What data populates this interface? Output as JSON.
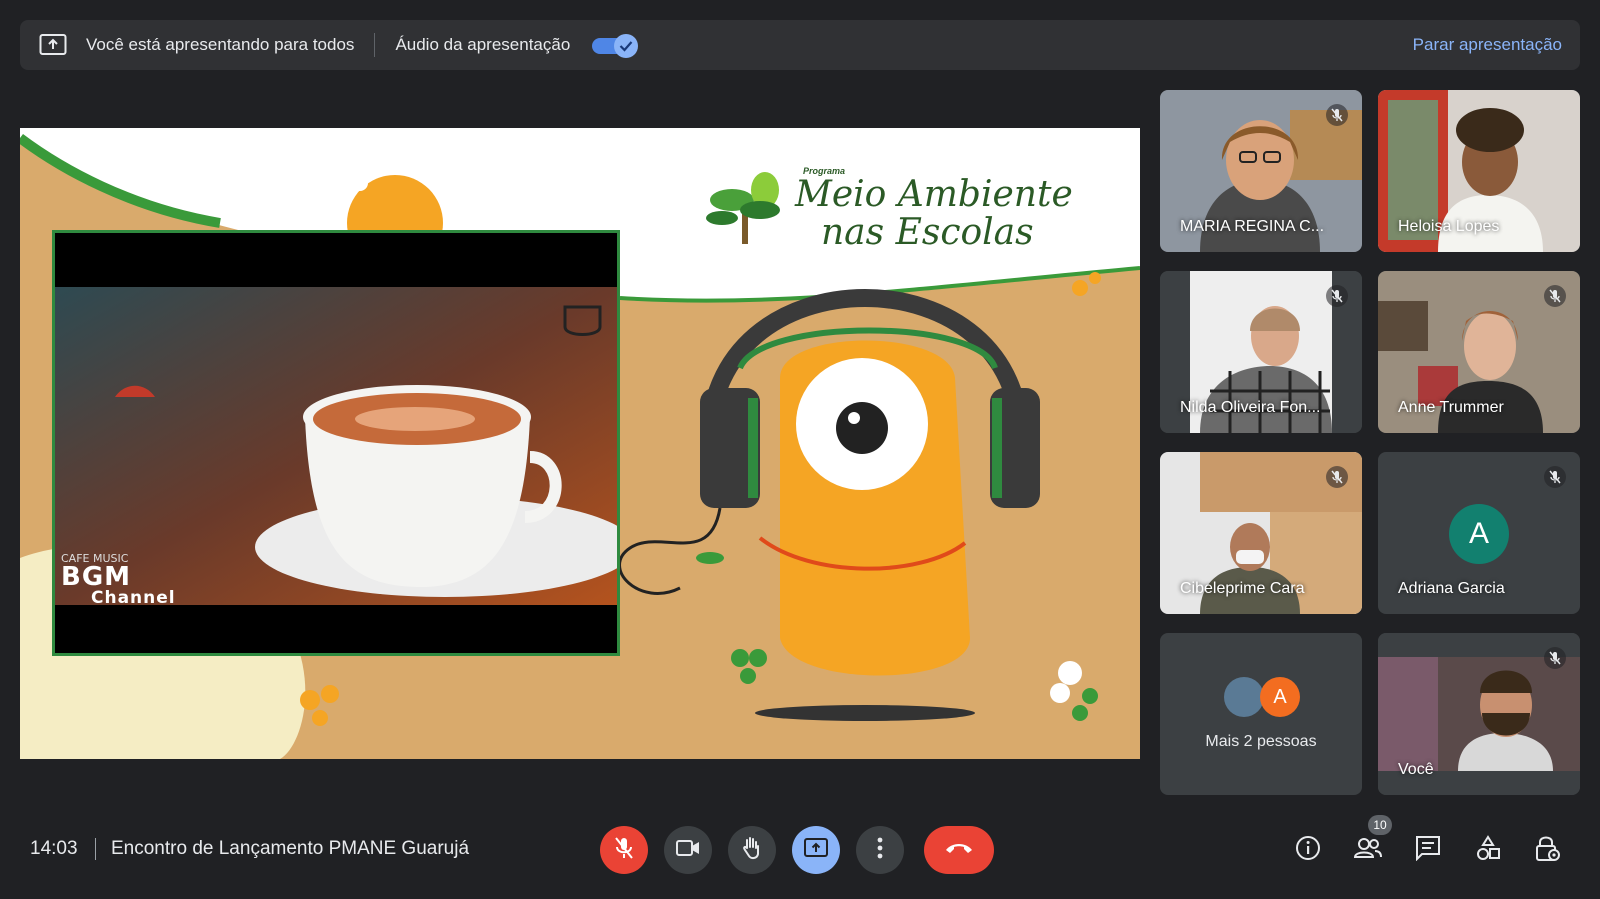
{
  "banner": {
    "presenting_text": "Você está apresentando para todos",
    "audio_label": "Áudio da apresentação",
    "audio_enabled": true,
    "stop_label": "Parar apresentação"
  },
  "slide": {
    "program_prefix": "Programa",
    "program_line1": "Meio Ambiente",
    "program_line2": "nas Escolas",
    "video_overlay_small": "CAFE MUSIC",
    "video_overlay_big": "BGM",
    "video_overlay_channel": "Channel"
  },
  "participants": [
    {
      "name": "MARIA REGINA C...",
      "muted": true
    },
    {
      "name": "Heloisa Lopes",
      "muted": false
    },
    {
      "name": "Nilda Oliveira Fon...",
      "muted": true
    },
    {
      "name": "Anne Trummer",
      "muted": true
    },
    {
      "name": "Cibeleprime Cara",
      "muted": true
    },
    {
      "name": "Adriana Garcia",
      "muted": true,
      "avatar_letter": "A",
      "avatar_color": "#12806f"
    },
    {
      "more_label": "Mais 2 pessoas",
      "avatar_letter": "A"
    },
    {
      "name": "Você",
      "muted": true
    }
  ],
  "bottom": {
    "time": "14:03",
    "meeting_title": "Encontro de Lançamento PMANE Guarujá",
    "participant_count": "10"
  },
  "controls": [
    {
      "name": "microphone-off-icon",
      "state": "muted"
    },
    {
      "name": "camera-icon"
    },
    {
      "name": "raise-hand-icon"
    },
    {
      "name": "present-screen-icon",
      "state": "active"
    },
    {
      "name": "more-options-icon"
    },
    {
      "name": "hang-up-icon"
    }
  ],
  "right_controls": [
    "info-icon",
    "people-icon",
    "chat-icon",
    "activities-icon",
    "host-controls-icon"
  ],
  "colors": {
    "background": "#202124",
    "accent": "#8ab4f8",
    "danger": "#ea4335",
    "tile": "#3c4043"
  }
}
